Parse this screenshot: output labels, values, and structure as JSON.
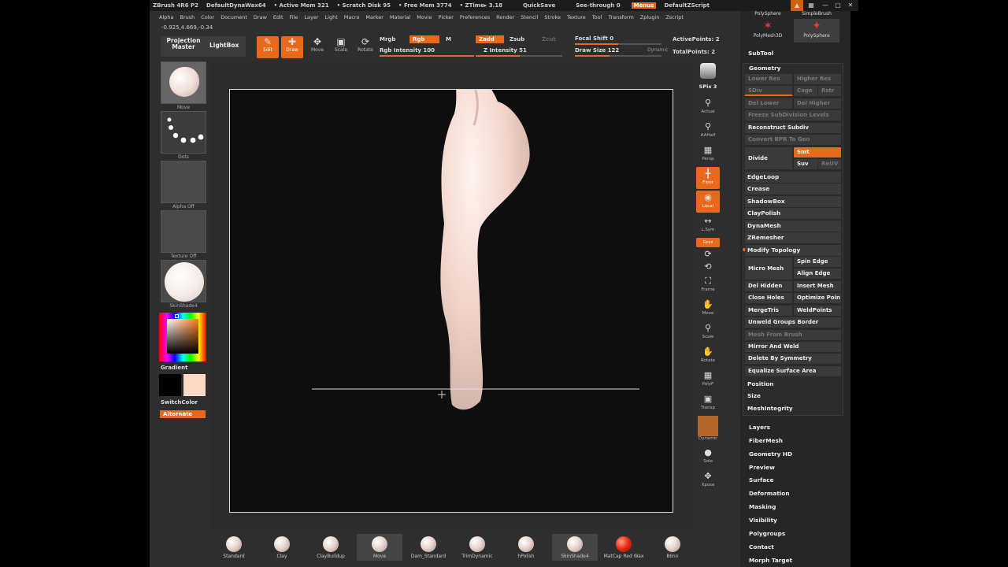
{
  "title_bar": {
    "app": "ZBrush 4R6 P2",
    "document": "DefaultDynaWax64",
    "active_mem": "• Active Mem 321",
    "scratch_disk": "• Scratch Disk 95",
    "free_mem": "• Free Mem 3774",
    "ztime": "• ZTime▸ 3.18",
    "quicksave": "QuickSave",
    "see_through": "See-through 0",
    "menus": "Menus",
    "zscript": "DefaultZScript"
  },
  "menu_bar": [
    "Alpha",
    "Brush",
    "Color",
    "Document",
    "Draw",
    "Edit",
    "File",
    "Layer",
    "Light",
    "Macro",
    "Marker",
    "Material",
    "Movie",
    "Picker",
    "Preferences",
    "Render",
    "Stencil",
    "Stroke",
    "Texture",
    "Tool",
    "Transform",
    "Zplugin",
    "Zscript"
  ],
  "coords": "-0.925,4.669,-0.34",
  "toolbar": {
    "projection_master": "Projection\nMaster",
    "lightbox": "LightBox",
    "edit": "Edit",
    "draw": "Draw",
    "move": "Move",
    "scale": "Scale",
    "rotate": "Rotate",
    "mrgb": "Mrgb",
    "rgb": "Rgb",
    "m": "M",
    "rgb_intensity": "Rgb Intensity 100",
    "zadd": "Zadd",
    "zsub": "Zsub",
    "zcut": "Zcut",
    "z_intensity": "Z Intensity 51",
    "focal_shift": "Focal Shift 0",
    "draw_size": "Draw Size 122",
    "dynamic": "Dynamic",
    "active_points": "ActivePoints: 2",
    "total_points": "TotalPoints: 2"
  },
  "left_shelf": {
    "brush": "Move",
    "stroke": "Dots",
    "alpha": "Alpha  Off",
    "texture": "Texture  Off",
    "material": "SkinShade4",
    "gradient": "Gradient",
    "switch_color": "SwitchColor",
    "alternate": "Alternate"
  },
  "right_shelf": [
    "BPR",
    "SPix 3",
    "Actual",
    "AAHalf",
    "Persp",
    "Floor",
    "Local",
    "L.Sym",
    "Gxyz",
    "",
    "",
    "Frame",
    "Move",
    "Scale",
    "Rotate",
    "PolyF",
    "Transp",
    "Dynamic",
    "Solo",
    "Xpose"
  ],
  "bottom_shelf": [
    "Standard",
    "Clay",
    "ClayBuildup",
    "Move",
    "Dam_Standard",
    "TrimDynamic",
    "hPolish",
    "SkinShade4",
    "MatCap Red Wax",
    "Blinn"
  ],
  "top_right": {
    "polysphere_top": "PolySphere",
    "simplebrush": "SimpleBrush",
    "polymesh3d": "PolyMesh3D",
    "polysphere": "PolySphere"
  },
  "subtool_panel": {
    "subtool": "SubTool",
    "geometry": "Geometry",
    "lower_res": "Lower Res",
    "higher_res": "Higher Res",
    "sdiv": "SDiv",
    "cage": "Cage",
    "rstr": "Rstr",
    "del_lower": "Del Lower",
    "del_higher": "Del Higher",
    "freeze": "Freeze SubDivision Levels",
    "reconstruct": "Reconstruct Subdiv",
    "convert_bpr": "Convert BPR To Geo",
    "divide": "Divide",
    "smt": "Smt",
    "suv": "Suv",
    "reuv": "ReUV",
    "edgeloop": "EdgeLoop",
    "crease": "Crease",
    "shadowbox": "ShadowBox",
    "claypolish": "ClayPolish",
    "dynamesh": "DynaMesh",
    "zremesher": "ZRemesher",
    "modify_topology": "Modify Topology",
    "micro_mesh": "Micro Mesh",
    "spin_edge": "Spin Edge",
    "align_edge": "Align Edge",
    "del_hidden": "Del Hidden",
    "insert_mesh": "Insert Mesh",
    "close_holes": "Close Holes",
    "optimize_points": "Optimize Poin",
    "mergetris": "MergeTris",
    "weldpoints": "WeldPoints",
    "unweld": "Unweld Groups Border",
    "mesh_from_brush": "Mesh From Brush",
    "mirror_weld": "Mirror And Weld",
    "delete_symmetry": "Delete By Symmetry",
    "equalize": "Equalize Surface Area",
    "position": "Position",
    "size": "Size",
    "meshintegrity": "MeshIntegrity"
  },
  "tool_subpalettes": [
    "Layers",
    "FiberMesh",
    "Geometry HD",
    "Preview",
    "Surface",
    "Deformation",
    "Masking",
    "Visibility",
    "Polygroups",
    "Contact",
    "Morph Target"
  ],
  "colors": {
    "accent": "#e8681c",
    "skin": "#f3d6cc",
    "primary_color": "#ffffff",
    "secondary_color": "#fbd9c6"
  },
  "slider_values": {
    "rgb_intensity": 100,
    "z_intensity": 51,
    "focal_shift": 0,
    "draw_size": 122
  }
}
